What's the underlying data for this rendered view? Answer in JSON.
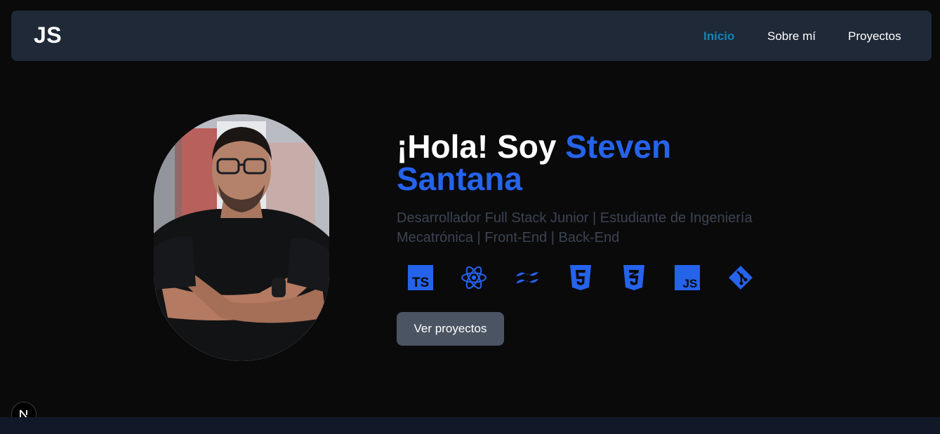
{
  "nav": {
    "logo": "JS",
    "links": [
      {
        "label": "Inicio",
        "active": true
      },
      {
        "label": "Sobre mí",
        "active": false
      },
      {
        "label": "Proyectos",
        "active": false
      }
    ]
  },
  "hero": {
    "title_prefix": "¡Hola! Soy ",
    "title_highlight": "Steven Santana",
    "subtitle": "Desarrollador Full Stack Junior | Estudiante de Ingeniería Mecatrónica | Front-End | Back-End",
    "tech_icons": [
      "typescript-icon",
      "react-icon",
      "tailwind-icon",
      "html5-icon",
      "css3-icon",
      "javascript-icon",
      "git-icon"
    ],
    "cta_label": "Ver proyectos"
  },
  "colors": {
    "background": "#0a0a0b",
    "navbar": "#1f2937",
    "active_link": "#1484b4",
    "accent": "#2563eb",
    "subtitle": "#3c4452",
    "button": "#4a5462"
  }
}
